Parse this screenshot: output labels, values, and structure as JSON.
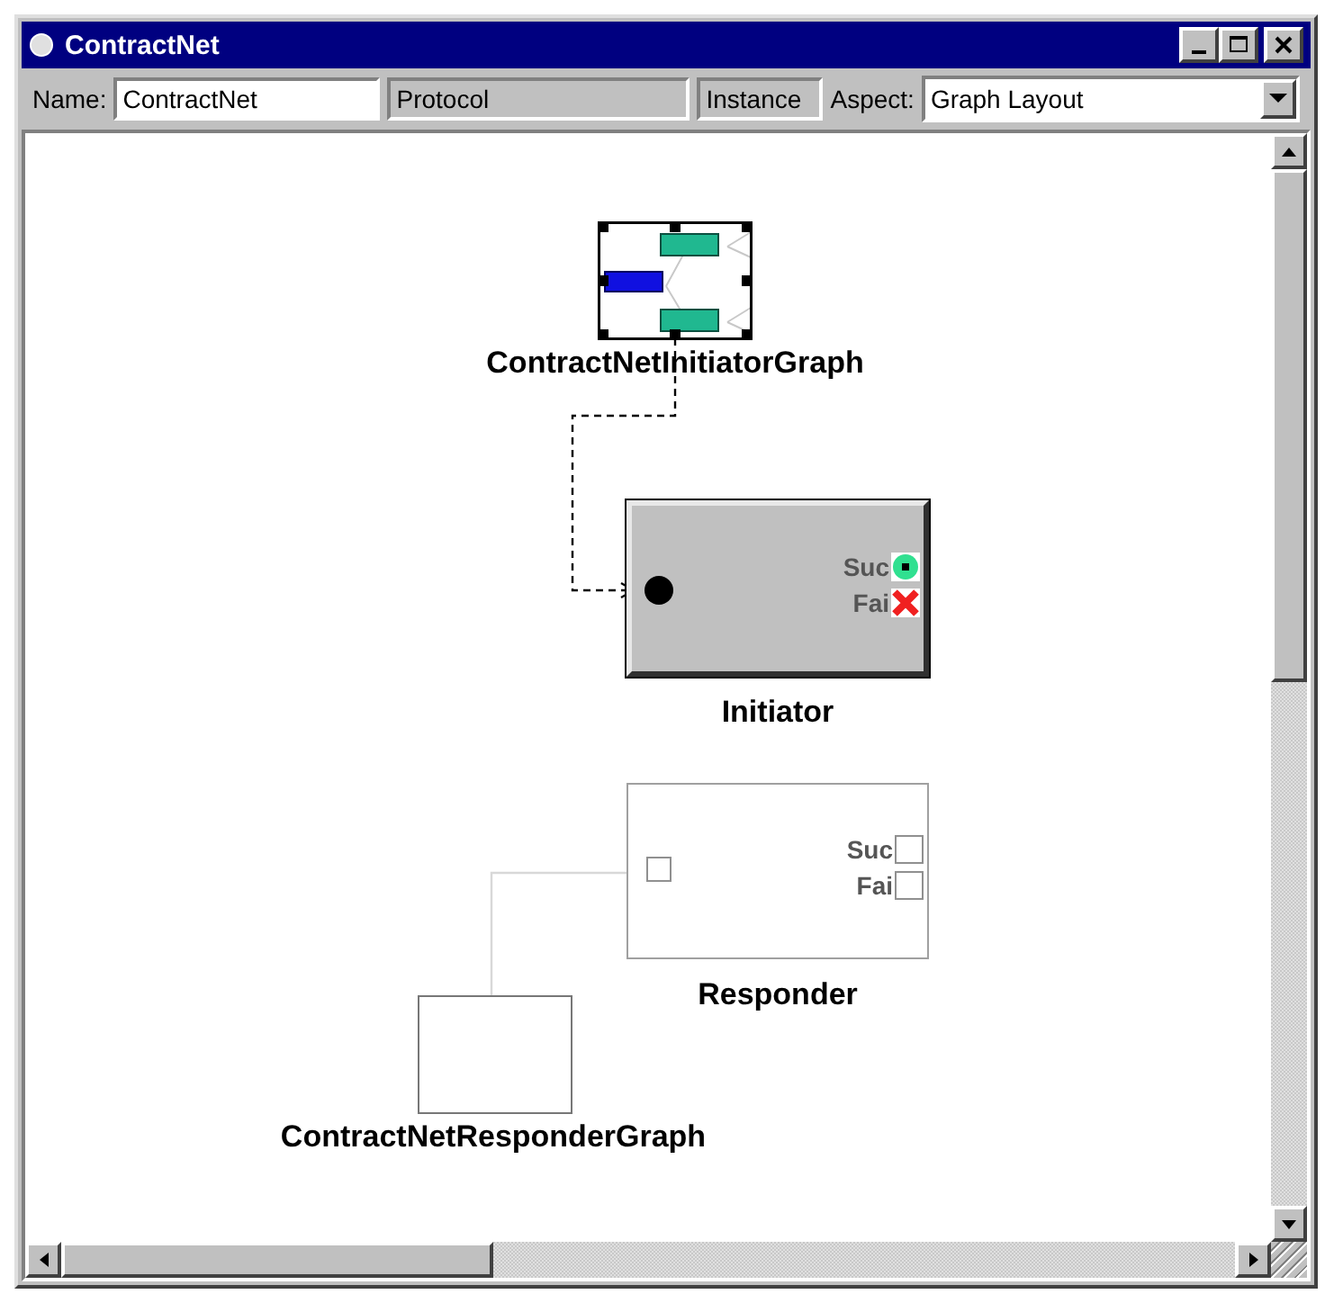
{
  "window": {
    "title": "ContractNet"
  },
  "toolbar": {
    "name_label": "Name:",
    "name_value": "ContractNet",
    "protocol": "Protocol",
    "instance": "Instance",
    "aspect_label": "Aspect:",
    "aspect_value": "Graph Layout"
  },
  "graphs": [
    {
      "label": "ContractNetInitiatorGraph",
      "selected": true
    },
    {
      "label": "ContractNetResponderGraph",
      "selected": false
    }
  ],
  "components": [
    {
      "label": "Initiator",
      "active": true,
      "ports": [
        {
          "label": "Suc",
          "kind": "success"
        },
        {
          "label": "Fai",
          "kind": "fail"
        }
      ]
    },
    {
      "label": "Responder",
      "active": false,
      "ports": [
        {
          "label": "Suc",
          "kind": "success"
        },
        {
          "label": "Fai",
          "kind": "fail"
        }
      ]
    }
  ],
  "connections": [
    {
      "kind": "dashed"
    },
    {
      "kind": "plain"
    }
  ]
}
